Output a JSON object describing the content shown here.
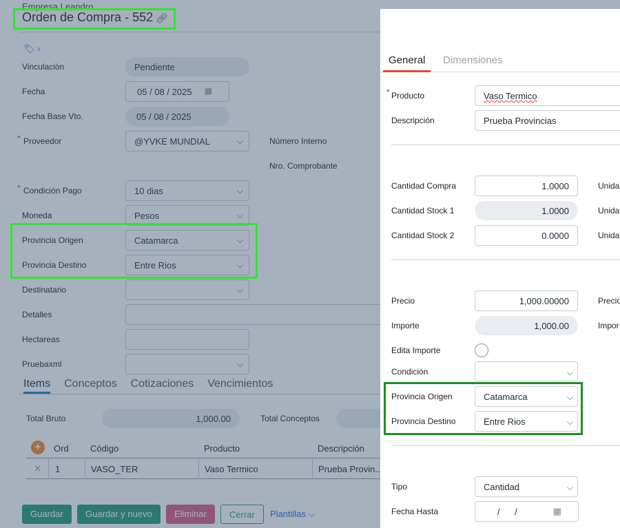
{
  "header": {
    "company": "Empresa Leandro",
    "title": "Orden de Compra - 552",
    "link_icon": "link-icon",
    "tag_icon": "tag-icon"
  },
  "form": {
    "vinculacion": {
      "label": "Vinculación",
      "value": "Pendiente"
    },
    "fecha": {
      "label": "Fecha",
      "day": "05",
      "month": "08",
      "year": "2025"
    },
    "fecha_base": {
      "label": "Fecha Base Vto.",
      "day": "05",
      "month": "08",
      "year": "2025"
    },
    "proveedor": {
      "label": "Proveedor",
      "value": "@YVKE MUNDIAL"
    },
    "numero_interno": {
      "label": "Número Interno"
    },
    "nro_comprobante": {
      "label": "Nro. Comprobante"
    },
    "condicion_pago": {
      "label": "Condición Pago",
      "value": "10 dias"
    },
    "moneda": {
      "label": "Moneda",
      "value": "Pesos"
    },
    "provincia_origen": {
      "label": "Provincia Origen",
      "value": "Catamarca"
    },
    "provincia_destino": {
      "label": "Provincia Destino",
      "value": "Entre Rios"
    },
    "destinatario": {
      "label": "Destinatario",
      "value": ""
    },
    "detalles": {
      "label": "Detalles",
      "value": ""
    },
    "hectareas": {
      "label": "Hectareas",
      "value": ""
    },
    "pruebaxml": {
      "label": "Pruebaxml",
      "value": ""
    },
    "required_mark": "*"
  },
  "tabs": [
    "Items",
    "Conceptos",
    "Cotizaciones",
    "Vencimientos"
  ],
  "totals": {
    "bruto_label": "Total Bruto",
    "bruto_value": "1,000.00",
    "conceptos_label": "Total Conceptos"
  },
  "grid": {
    "headers": [
      "Ord",
      "Código",
      "Producto",
      "Descripción"
    ],
    "rows": [
      {
        "ord": "1",
        "codigo": "VASO_TER",
        "producto": "Vaso Termico",
        "descripcion": "Prueba Provin..."
      }
    ]
  },
  "buttons": {
    "guardar": "Guardar",
    "guardar_nuevo": "Guardar y nuevo",
    "eliminar": "Eliminar",
    "cerrar": "Cerrar",
    "plantillas": "Plantillas"
  },
  "panel": {
    "tabs": [
      "General",
      "Dimensiones"
    ],
    "producto": {
      "label": "Producto",
      "value": "Vaso Termico"
    },
    "descripcion": {
      "label": "Descripción",
      "value": "Prueba Provincias"
    },
    "cantidad_compra": {
      "label": "Cantidad Compra",
      "value": "1.0000"
    },
    "cantidad_stock1": {
      "label": "Cantidad Stock 1",
      "value": "1.0000"
    },
    "cantidad_stock2": {
      "label": "Cantidad Stock 2",
      "value": "0.0000"
    },
    "unidad_label": "Unida",
    "precio": {
      "label": "Precio",
      "value": "1,000.00000"
    },
    "precio_right_label": "Precio",
    "importe": {
      "label": "Importe",
      "value": "1,000.00"
    },
    "importe_right_label": "Impor",
    "edita_importe": {
      "label": "Edita Importe"
    },
    "condicion": {
      "label": "Condición",
      "value": ""
    },
    "provincia_origen": {
      "label": "Provincia Origen",
      "value": "Catamarca"
    },
    "provincia_destino": {
      "label": "Provincia Destino",
      "value": "Entre Rios"
    },
    "tipo": {
      "label": "Tipo",
      "value": "Cantidad"
    },
    "fecha_hasta": {
      "label": "Fecha Hasta",
      "sep": "/"
    }
  },
  "colors": {
    "highlight_bright": "#2ee62e",
    "highlight_dark": "#1f8f1f",
    "tab_active": "#e5472f",
    "primary": "#1f9a78"
  }
}
